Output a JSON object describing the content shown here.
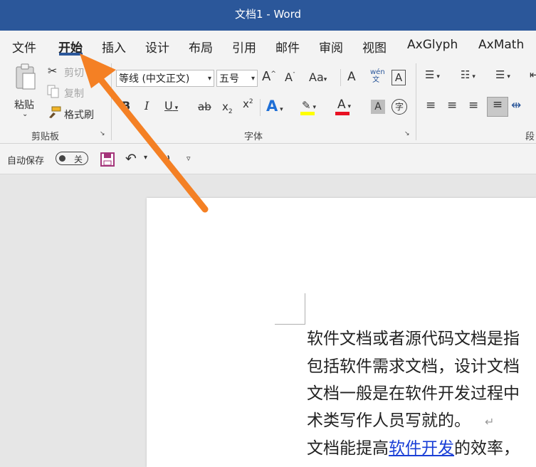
{
  "window": {
    "title": "文档1  -  Word"
  },
  "tabs": [
    {
      "label": "文件"
    },
    {
      "label": "开始"
    },
    {
      "label": "插入"
    },
    {
      "label": "设计"
    },
    {
      "label": "布局"
    },
    {
      "label": "引用"
    },
    {
      "label": "邮件"
    },
    {
      "label": "审阅"
    },
    {
      "label": "视图"
    },
    {
      "label": "AxGlyph"
    },
    {
      "label": "AxMath"
    }
  ],
  "clipboard": {
    "paste": "粘贴",
    "cut": "剪切",
    "copy": "复制",
    "format_painter": "格式刷",
    "group": "剪贴板"
  },
  "font": {
    "name": "等线 (中文正文)",
    "size": "五号",
    "group": "字体"
  },
  "paragraph": {
    "group": "段"
  },
  "qat": {
    "autosave_label": "自动保存",
    "autosave_state": "关"
  },
  "doc": {
    "line1": "软件文档或者源代码文档是指",
    "line2": "包括软件需求文档，设计文档",
    "line3": "文档一般是在软件开发过程中",
    "line4": "术类写作人员写就的。",
    "line4_mark": "↵",
    "line5_pre": "文档能提高",
    "line5_link": "软件开发",
    "line5_post": "的效率，"
  },
  "colors": {
    "title_bar": "#2b579a",
    "highlight": "#ffff00",
    "font_color": "#e81123",
    "arrow": "#f48024",
    "link": "#1a3fd6"
  }
}
